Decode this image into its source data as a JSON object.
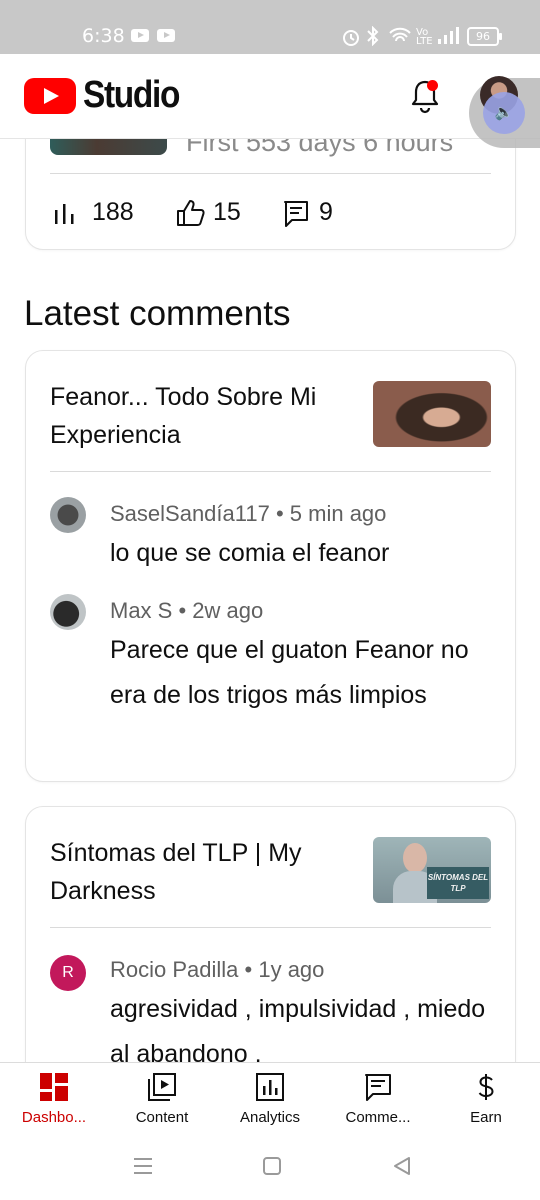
{
  "status_bar": {
    "time": "6:38",
    "battery": "96"
  },
  "app_bar": {
    "title": "Studio"
  },
  "top_video": {
    "duration_text": "First 553 days 6 hours",
    "views": "188",
    "likes": "15",
    "comments": "9"
  },
  "section": {
    "title": "Latest comments"
  },
  "videos": [
    {
      "title": "Feanor... Todo Sobre Mi Experiencia",
      "comments": [
        {
          "author": "SaselSandía117",
          "time": "5 min ago",
          "text": "lo que se comia el feanor"
        },
        {
          "author": "Max S",
          "time": "2w ago",
          "text": "Parece que el guaton Feanor no era de los trigos más limpios"
        }
      ]
    },
    {
      "title": "Síntomas del TLP | My Darkness",
      "thumb_label": "SÍNTOMAS DEL TLP",
      "comments": [
        {
          "author": "Rocio Padilla",
          "avatar_letter": "R",
          "time": "1y ago",
          "text": "agresividad , impulsividad , miedo al abandono ,"
        }
      ]
    }
  ],
  "bottom_nav": [
    {
      "label": "Dashbo...",
      "icon": "dashboard-icon",
      "active": true
    },
    {
      "label": "Content",
      "icon": "content-icon"
    },
    {
      "label": "Analytics",
      "icon": "analytics-icon"
    },
    {
      "label": "Comme...",
      "icon": "comments-icon"
    },
    {
      "label": "Earn",
      "icon": "dollar-icon"
    }
  ],
  "colors": {
    "accent_red": "#cc0000",
    "brand_red": "#ff0000",
    "text": "#0f0f0f",
    "secondary_text": "#606060"
  }
}
